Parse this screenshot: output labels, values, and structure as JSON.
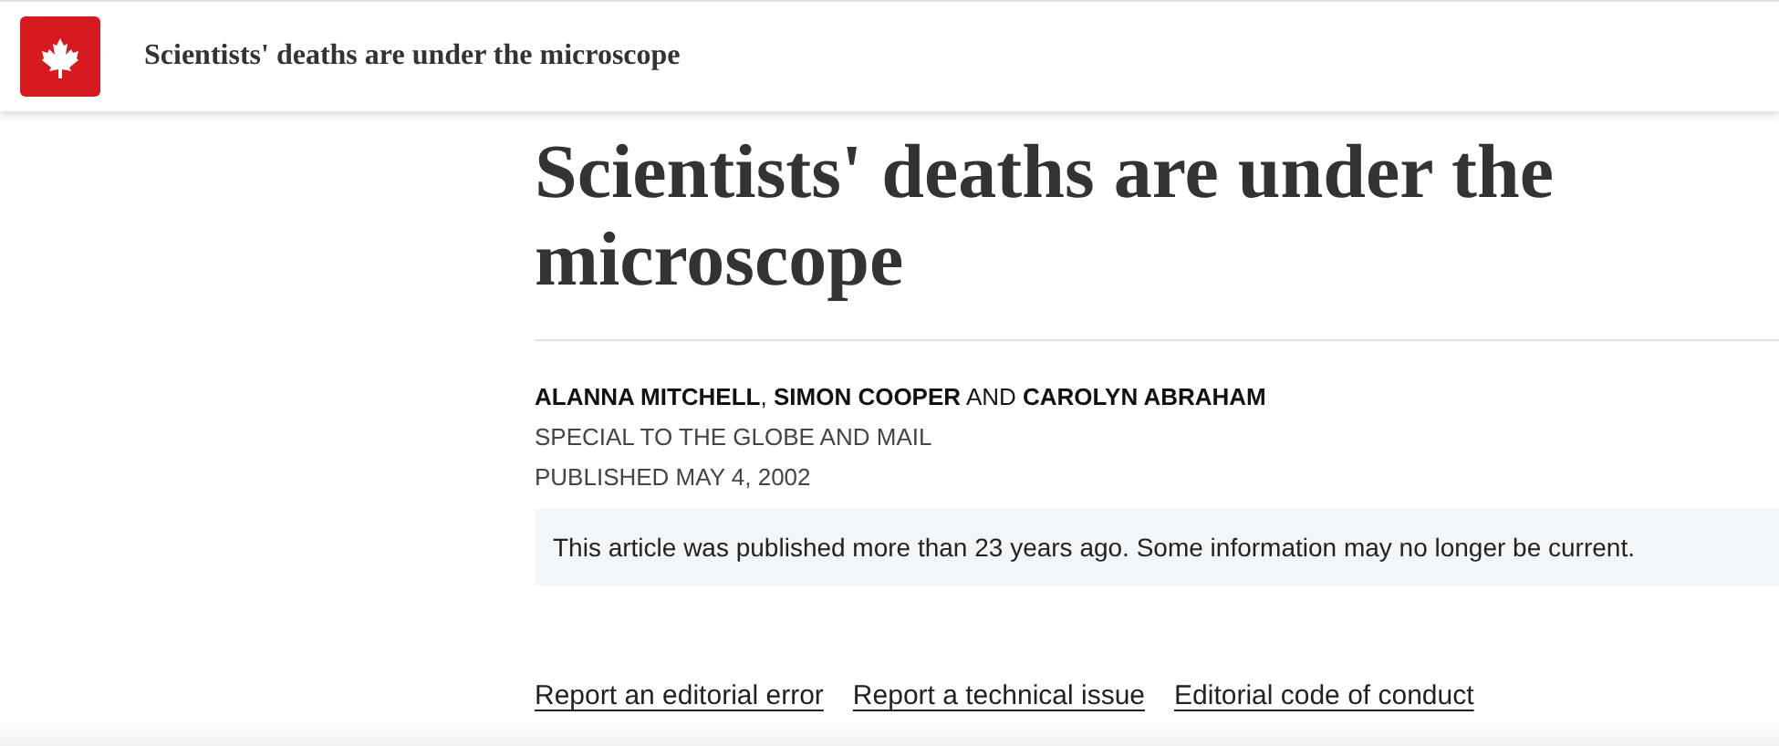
{
  "header": {
    "title": "Scientists' deaths are under the microscope"
  },
  "article": {
    "headline": "Scientists' deaths are under the microscope",
    "byline": "**ALANNA MITCHELL**, **SIMON COOPER** AND **CAROLYN ABRAHAM**",
    "source": "SPECIAL TO THE GLOBE AND MAIL",
    "published": "PUBLISHED MAY 4, 2002",
    "notice": "This article was published more than 23 years ago. Some information may no longer be current."
  },
  "footer_links": [
    "Report an editorial error",
    "Report a technical issue",
    "Editorial code of conduct"
  ]
}
